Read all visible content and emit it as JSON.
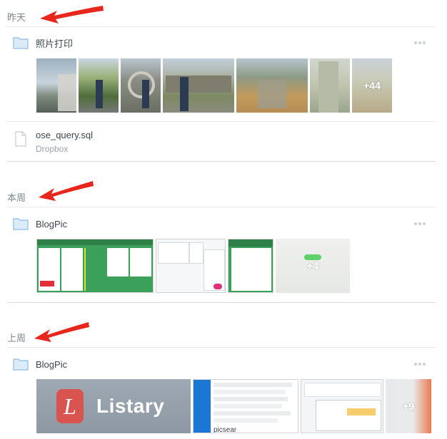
{
  "sections": {
    "yesterday": {
      "label": "昨天"
    },
    "this_week": {
      "label": "本周"
    },
    "last_week": {
      "label": "上周"
    }
  },
  "yesterday": {
    "folder": {
      "name": "照片打印"
    },
    "photos_more": "+44",
    "file": {
      "name": "ose_query.sql",
      "source": "Dropbox"
    }
  },
  "this_week": {
    "folder": {
      "name": "BlogPic"
    },
    "photos_more": "+4"
  },
  "last_week": {
    "folder": {
      "name": "BlogPic"
    },
    "photos_more": "+9",
    "listary_text": "Listary",
    "listary_logo_letter": "L",
    "picsearch_text": "picsear"
  },
  "colors": {
    "accent_arrow": "#e8261c",
    "folder_blue": "#8fbce6",
    "green_app": "#3aa05a"
  }
}
